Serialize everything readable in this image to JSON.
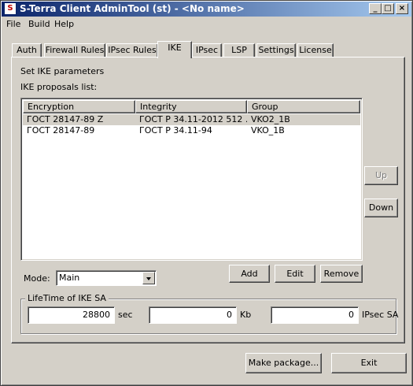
{
  "window": {
    "title": "S-Terra Client AdminTool (st) - <No name>",
    "controls": {
      "minimize": "_",
      "maximize": "□",
      "close": "×"
    }
  },
  "menu": [
    "File",
    "Build",
    "Help"
  ],
  "tabs": [
    "Auth",
    "Firewall Rules",
    "IPsec Rules",
    "IKE",
    "IPsec",
    "LSP",
    "Settings",
    "License"
  ],
  "active_tab": "IKE",
  "ike": {
    "section_title": "Set IKE parameters",
    "list_label": "IKE proposals list:",
    "columns": [
      "Encryption",
      "Integrity",
      "Group"
    ],
    "rows": [
      {
        "encryption": "ГОСТ 28147-89 Z",
        "integrity": "ГОСТ Р 34.11-2012 512 ...",
        "group": "VKO2_1B",
        "selected": true
      },
      {
        "encryption": "ГОСТ 28147-89",
        "integrity": "ГОСТ Р 34.11-94",
        "group": "VKO_1B",
        "selected": false
      }
    ],
    "buttons": {
      "up": "Up",
      "down": "Down",
      "add": "Add",
      "edit": "Edit",
      "remove": "Remove"
    },
    "mode_label": "Mode:",
    "mode_value": "Main",
    "lifetime": {
      "title": "LifeTime of IKE SA",
      "seconds": "28800",
      "seconds_unit": "sec",
      "kb": "0",
      "kb_unit": "Kb",
      "ipsec_sa": "0",
      "ipsec_sa_unit": "IPsec SA"
    }
  },
  "footer": {
    "make_package": "Make package...",
    "exit": "Exit"
  },
  "colors": {
    "face": "#d4d0c8",
    "title_start": "#0a246a",
    "title_end": "#a6caf0",
    "disabled_text": "#808080"
  }
}
